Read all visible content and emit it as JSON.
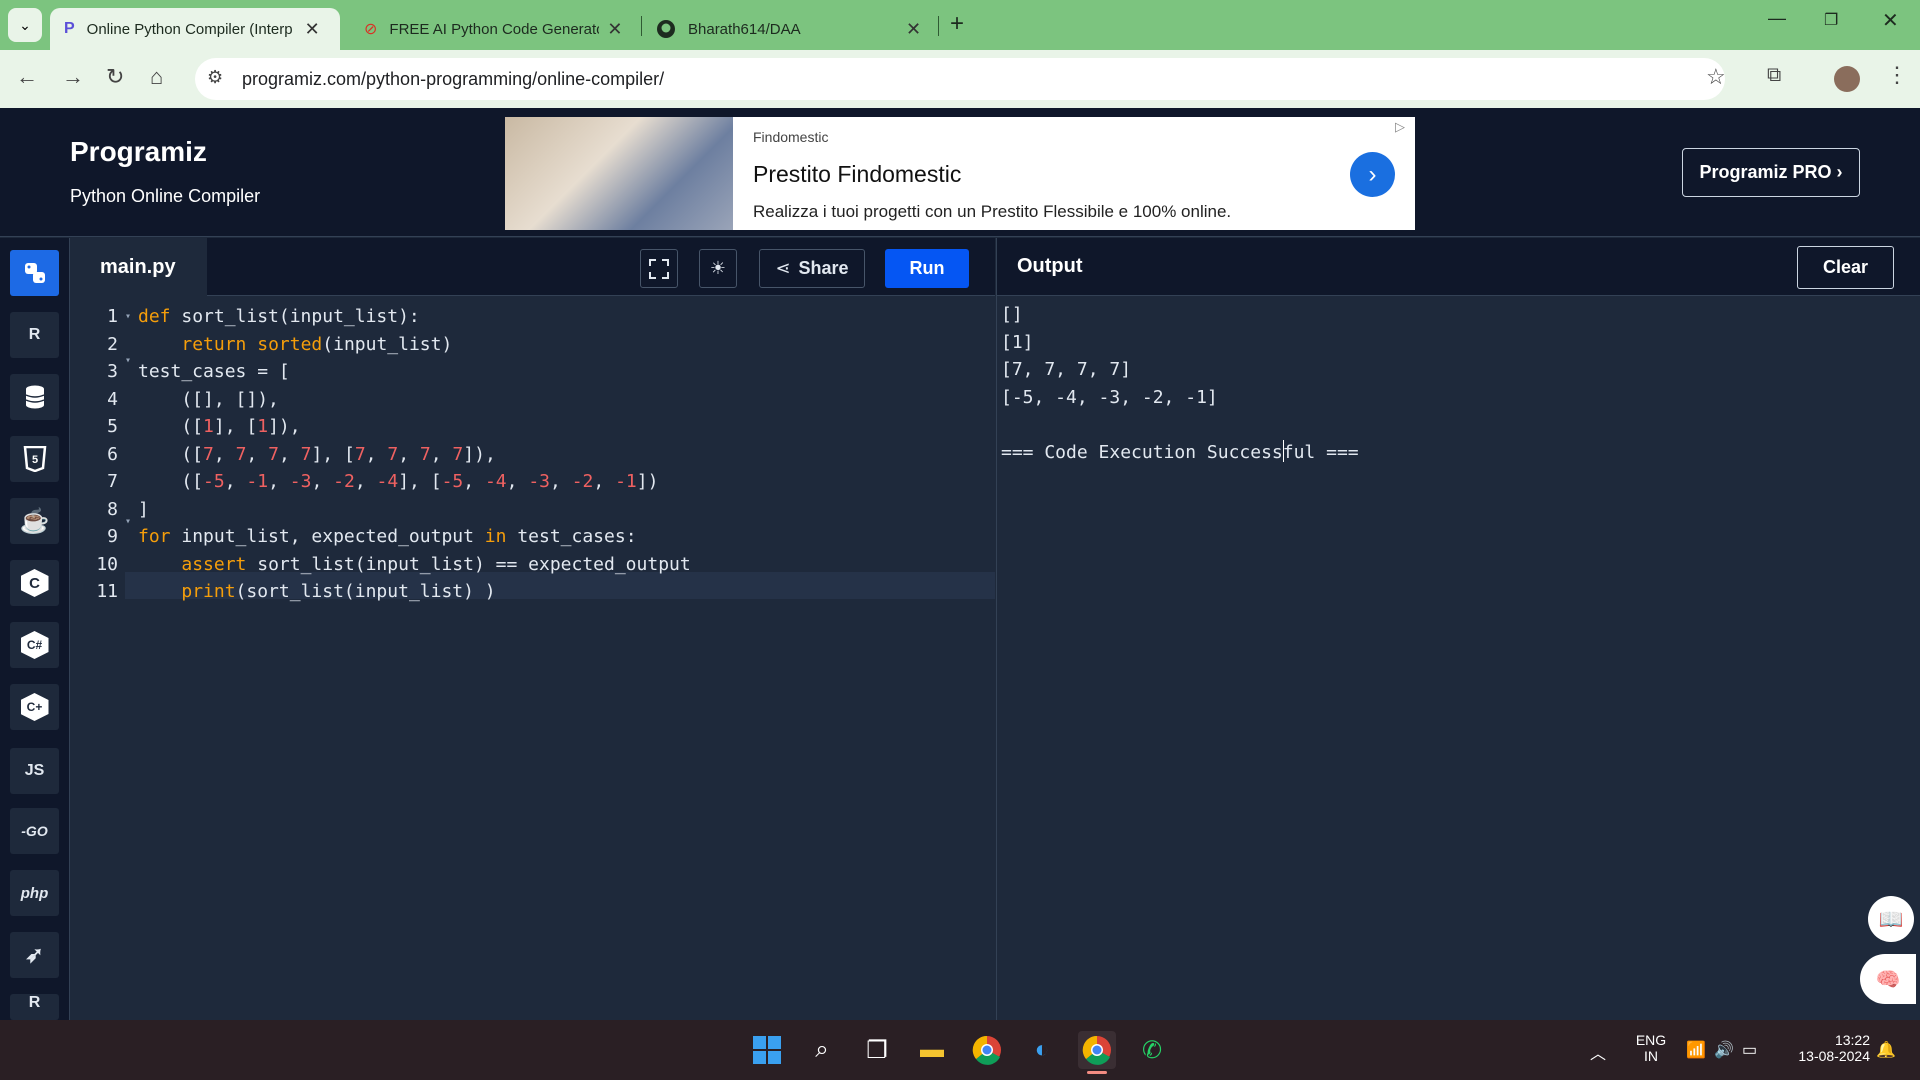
{
  "browser": {
    "tabs": [
      {
        "title": "Online Python Compiler (Interp",
        "icon": "programiz-favicon"
      },
      {
        "title": "FREE AI Python Code Generator",
        "icon": "codeconvert-favicon"
      },
      {
        "title": "Bharath614/DAA",
        "icon": "github-icon"
      }
    ],
    "new_tab": "+",
    "url": "programiz.com/python-programming/online-compiler/"
  },
  "site": {
    "logo": "Programiz",
    "subtitle": "Python Online Compiler",
    "pro_button": "Programiz PRO ›"
  },
  "ad": {
    "advertiser": "Findomestic",
    "title": "Prestito Findomestic",
    "body": "Realizza i tuoi progetti con un Prestito Flessibile e 100% online."
  },
  "sidebar": {
    "languages": [
      {
        "name": "python",
        "label": "",
        "icon": "python-icon"
      },
      {
        "name": "r",
        "label": "R",
        "icon": "r-icon"
      },
      {
        "name": "sql",
        "label": "",
        "icon": "database-icon"
      },
      {
        "name": "html",
        "label": "5",
        "icon": "html5-icon"
      },
      {
        "name": "java",
        "label": "",
        "icon": "java-icon"
      },
      {
        "name": "c",
        "label": "C",
        "icon": "c-icon"
      },
      {
        "name": "csharp",
        "label": "C#",
        "icon": "csharp-icon"
      },
      {
        "name": "cpp",
        "label": "C+",
        "icon": "cpp-icon"
      },
      {
        "name": "javascript",
        "label": "JS",
        "icon": "js-icon"
      },
      {
        "name": "go",
        "label": "-GO",
        "icon": "go-icon"
      },
      {
        "name": "php",
        "label": "php",
        "icon": "php-icon"
      },
      {
        "name": "swift",
        "label": "",
        "icon": "swift-icon"
      },
      {
        "name": "rust",
        "label": "R",
        "icon": "rust-icon"
      }
    ]
  },
  "editor": {
    "filename": "main.py",
    "share_label": "Share",
    "run_label": "Run",
    "line_numbers": [
      "1",
      "2",
      "3",
      "4",
      "5",
      "6",
      "7",
      "8",
      "9",
      "10",
      "11"
    ],
    "lines": [
      "def sort_list(input_list):",
      "    return sorted(input_list)",
      "test_cases = [",
      "    ([], []),",
      "    ([1], [1]),",
      "    ([7, 7, 7, 7], [7, 7, 7, 7]),",
      "    ([-5, -1, -3, -2, -4], [-5, -4, -3, -2, -1])",
      "]",
      "for input_list, expected_output in test_cases:",
      "    assert sort_list(input_list) == expected_output",
      "    print(sort_list(input_list) )"
    ]
  },
  "output": {
    "title": "Output",
    "clear_label": "Clear",
    "lines": [
      "[]",
      "[1]",
      "[7, 7, 7, 7]",
      "[-5, -4, -3, -2, -1]",
      "",
      "=== Code Execution Successful ==="
    ]
  },
  "taskbar": {
    "lang_top": "ENG",
    "lang_bottom": "IN",
    "time": "13:22",
    "date": "13-08-2024"
  },
  "colors": {
    "tabbar": "#7cc47f",
    "run": "#0556f3",
    "editor_bg": "#1e293b",
    "keyword": "#f59e0b",
    "number": "#ef6161"
  }
}
